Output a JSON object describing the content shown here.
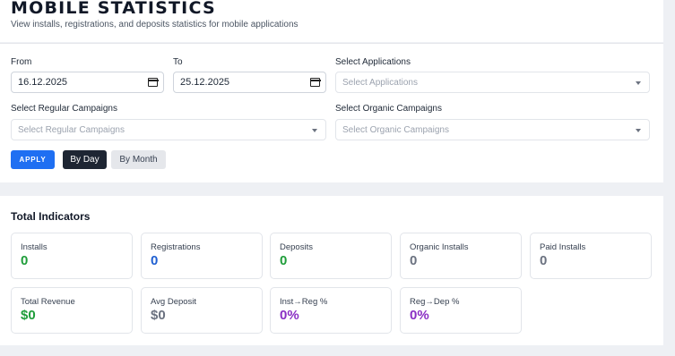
{
  "header": {
    "title": "MOBILE STATISTICS",
    "subtitle": "View installs, registrations, and deposits statistics for mobile applications"
  },
  "filters": {
    "from_label": "From",
    "from_value": "16.12.2025",
    "to_label": "To",
    "to_value": "25.12.2025",
    "applications_label": "Select Applications",
    "applications_placeholder": "Select Applications",
    "regular_label": "Select Regular Campaigns",
    "regular_placeholder": "Select Regular Campaigns",
    "organic_label": "Select Organic Campaigns",
    "organic_placeholder": "Select Organic Campaigns",
    "apply_label": "APPLY",
    "by_day_label": "By Day",
    "by_month_label": "By Month"
  },
  "indicators": {
    "title": "Total Indicators",
    "cards": [
      {
        "label": "Installs",
        "value": "0",
        "color": "#1f9d3a"
      },
      {
        "label": "Registrations",
        "value": "0",
        "color": "#1f5fd1"
      },
      {
        "label": "Deposits",
        "value": "0",
        "color": "#1f9d3a"
      },
      {
        "label": "Organic Installs",
        "value": "0",
        "color": "#6b7280"
      },
      {
        "label": "Paid Installs",
        "value": "0",
        "color": "#6b7280"
      },
      {
        "label": "Total Revenue",
        "value": "$0",
        "color": "#1f9d3a"
      },
      {
        "label": "Avg Deposit",
        "value": "$0",
        "color": "#6b7280"
      },
      {
        "label": "Inst→Reg %",
        "value": "0%",
        "color": "#8a2fc4"
      },
      {
        "label": "Reg→Dep %",
        "value": "0%",
        "color": "#8a2fc4"
      }
    ]
  }
}
